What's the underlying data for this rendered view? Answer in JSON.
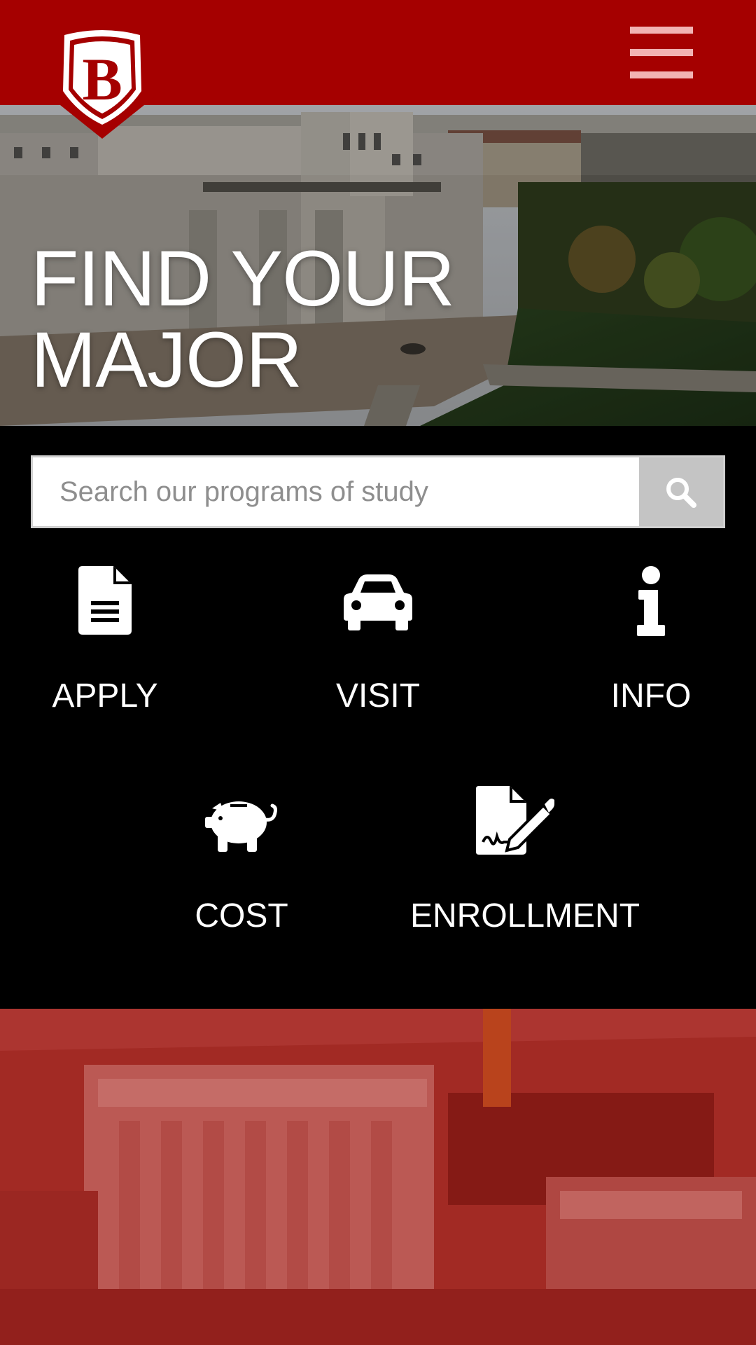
{
  "header": {
    "logo_letter": "B",
    "logo_alt": "B",
    "menu_icon": "hamburger-menu-icon",
    "background_color": "#a50000"
  },
  "hero": {
    "title_line1": "FIND YOUR",
    "title_line2": "MAJOR"
  },
  "search": {
    "placeholder": "Search our programs of study",
    "value": "",
    "button_icon": "search-icon"
  },
  "actions": [
    {
      "label": "APPLY",
      "icon": "document-icon"
    },
    {
      "label": "VISIT",
      "icon": "car-icon"
    },
    {
      "label": "INFO",
      "icon": "info-icon"
    },
    {
      "label": "COST",
      "icon": "piggy-bank-icon"
    },
    {
      "label": "ENROLLMENT",
      "icon": "signed-document-icon"
    }
  ],
  "colors": {
    "brand_red": "#a50000",
    "menu_bars": "#f2b3b3",
    "page_background": "#000000",
    "search_button": "#c4c4c4"
  }
}
